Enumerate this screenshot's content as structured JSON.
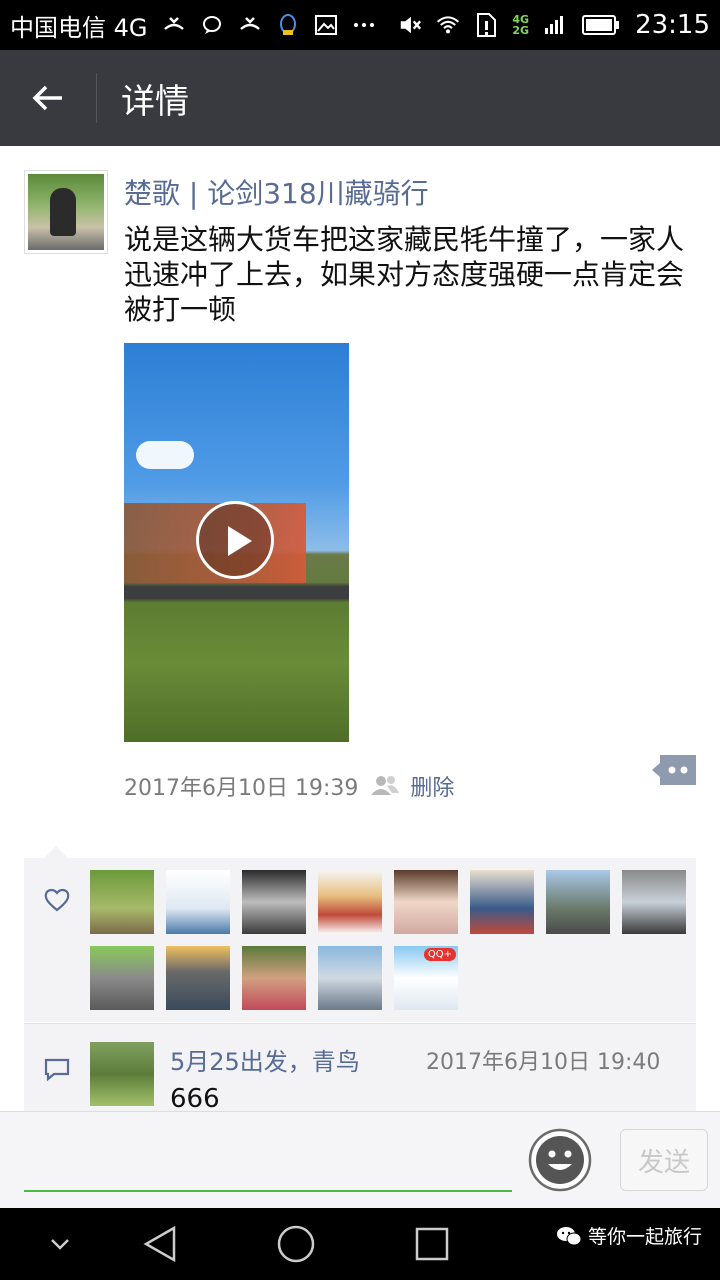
{
  "status_bar": {
    "carrier": "中国电信 4G",
    "network_badge_top": "4G",
    "network_badge_bottom": "2G",
    "time": "23:15"
  },
  "header": {
    "title": "详情"
  },
  "post": {
    "author": "楚歌 | 论剑318川藏骑行",
    "text": "说是这辆大货车把这家藏民牦牛撞了，一家人迅速冲了上去，如果对方态度强硬一点肯定会被打一顿",
    "timestamp": "2017年6月10日 19:39",
    "delete_label": "删除"
  },
  "likes": {
    "avatars": [
      {
        "name": "like-avatar-1",
        "bg": "linear-gradient(180deg,#6b9a3a,#a7b96a 60%,#7b6a4a)"
      },
      {
        "name": "like-avatar-2",
        "bg": "linear-gradient(180deg,#ffffff,#dfe9f2 60%,#4a7aa8)"
      },
      {
        "name": "like-avatar-3",
        "bg": "linear-gradient(180deg,#2b2b2b,#bdbdbd 50%,#3b3b3b)"
      },
      {
        "name": "like-avatar-4",
        "bg": "linear-gradient(180deg,#f5f5f5,#e8c080 40%,#c04a3a 70%,#fafafa)"
      },
      {
        "name": "like-avatar-5",
        "bg": "linear-gradient(180deg,#5a3a2a,#f0d8c8 50%,#d0a8a0)"
      },
      {
        "name": "like-avatar-6",
        "bg": "linear-gradient(180deg,#e9e0d0,#3a5a8a 60%,#c04a3a)"
      },
      {
        "name": "like-avatar-7",
        "bg": "linear-gradient(180deg,#aac8e8,#6a7a6a 60%,#4a4a4a)"
      },
      {
        "name": "like-avatar-8",
        "bg": "linear-gradient(180deg,#8a8a8a,#c8d0d8 50%,#3a3a3a)"
      },
      {
        "name": "like-avatar-9",
        "bg": "linear-gradient(180deg,#8ac85a,#8a8a8a 50%,#5a5a5a)"
      },
      {
        "name": "like-avatar-10",
        "bg": "linear-gradient(180deg,#f0c060,#6a6a6a 40%,#3a4a5a)"
      },
      {
        "name": "like-avatar-11",
        "bg": "linear-gradient(180deg,#5a7a3a,#d0a080 50%,#c04a5a)"
      },
      {
        "name": "like-avatar-12",
        "bg": "linear-gradient(180deg,#8ab8e0,#d0d8e0 50%,#6a7a8a)"
      },
      {
        "name": "like-avatar-13",
        "bg": "linear-gradient(180deg,#88c8f0,#ffffff 50%,#dfe8f0)"
      }
    ],
    "badge_text": "QQ+"
  },
  "comment": {
    "author": "5月25出发，青鸟",
    "time": "2017年6月10日 19:40",
    "text": "666"
  },
  "input_bar": {
    "send_label": "发送"
  },
  "watermark": {
    "text": "等你一起旅行"
  },
  "colors": {
    "link": "#576b95",
    "header_bg": "#393a3f",
    "accent_green": "#4cb848"
  }
}
